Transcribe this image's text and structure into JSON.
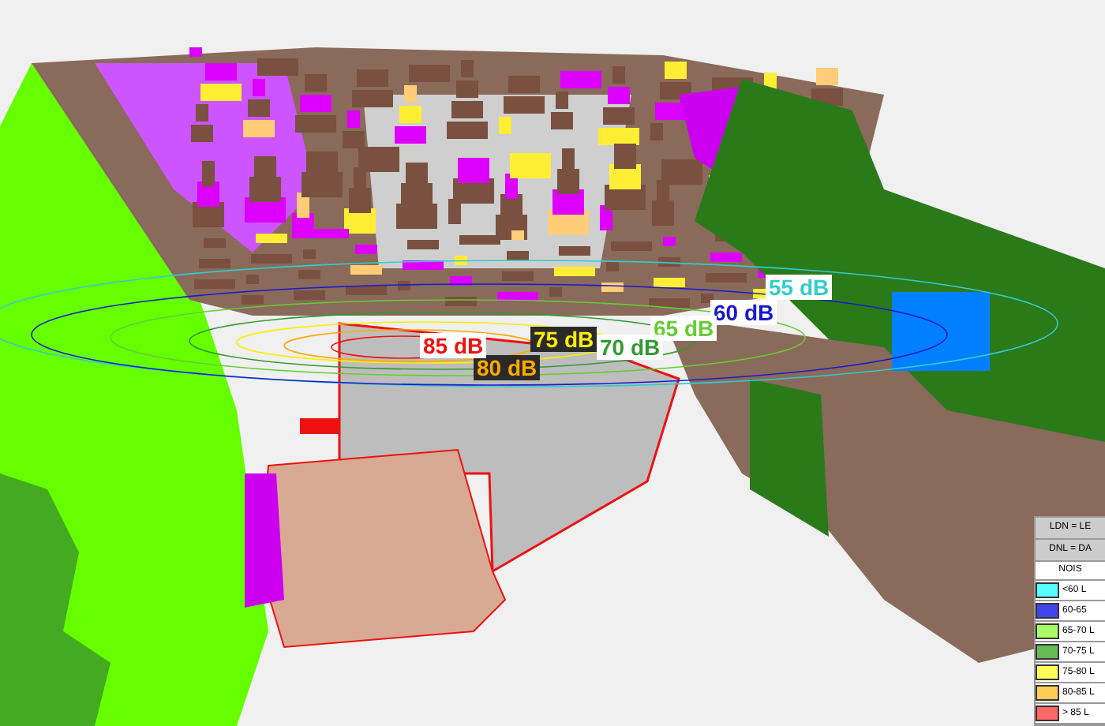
{
  "contours": [
    {
      "label": "55 dB",
      "color": "#33cccc"
    },
    {
      "label": "60 dB",
      "color": "#1a1acc"
    },
    {
      "label": "65 dB",
      "color": "#66cc33"
    },
    {
      "label": "70 dB",
      "color": "#339933"
    },
    {
      "label": "75 dB",
      "color": "#ffee00"
    },
    {
      "label": "80 dB",
      "color": "#ffaa00"
    },
    {
      "label": "85 dB",
      "color": "#ee1111"
    }
  ],
  "legend": {
    "header_1": "LDN = LE",
    "header_2": "DNL = DA",
    "title": "NOIS",
    "items": [
      {
        "label": "<60  L",
        "color": "#55ffff"
      },
      {
        "label": "60-65",
        "color": "#4444ee"
      },
      {
        "label": "65-70 L",
        "color": "#aaff66"
      },
      {
        "label": "70-75 L",
        "color": "#66bb55"
      },
      {
        "label": "75-80 L",
        "color": "#ffff55"
      },
      {
        "label": "80-85 L",
        "color": "#ffcc55"
      },
      {
        "label": "> 85 L",
        "color": "#ff6666"
      }
    ]
  }
}
